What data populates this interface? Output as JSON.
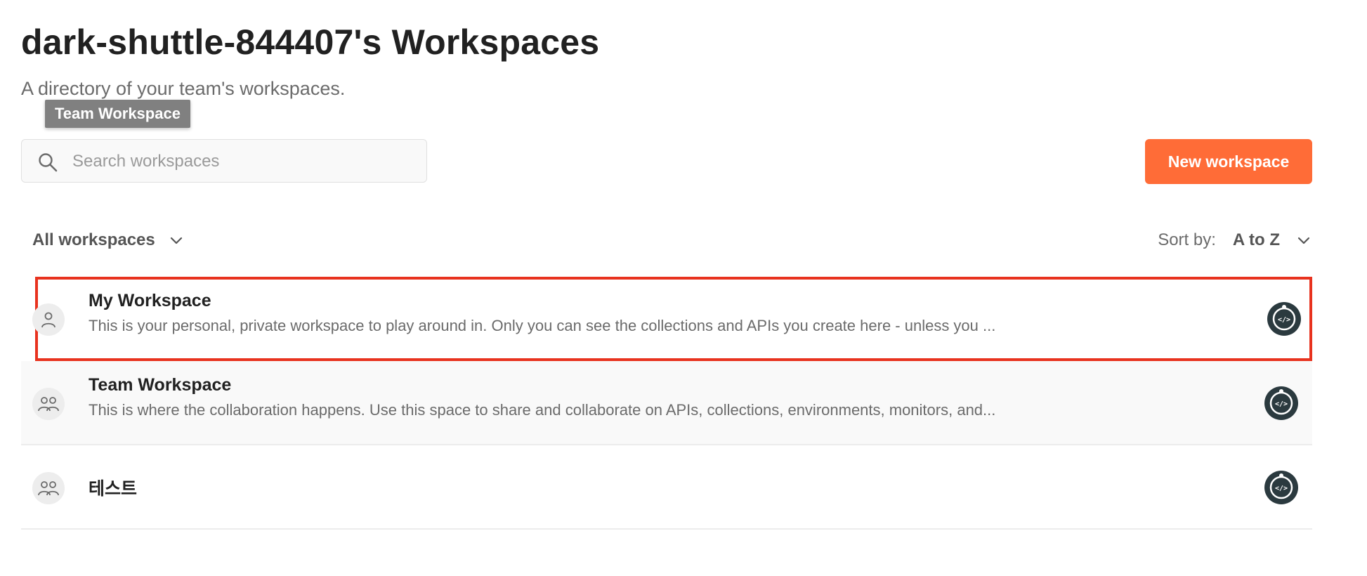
{
  "page": {
    "title": "dark-shuttle-844407's Workspaces",
    "subtitle": "A directory of your team's workspaces."
  },
  "tooltip": {
    "text": "Team Workspace"
  },
  "search": {
    "placeholder": "Search workspaces",
    "value": "",
    "icon": "search-icon"
  },
  "toolbar": {
    "new_workspace_label": "New workspace"
  },
  "filter": {
    "label": "All workspaces",
    "icon": "chevron-down-icon"
  },
  "sort": {
    "label": "Sort by:",
    "value": "A to Z",
    "icon": "chevron-down-icon"
  },
  "workspaces": [
    {
      "name": "My Workspace",
      "description": "This is your personal, private workspace to play around in. Only you can see the collections and APIs you create here - unless you ...",
      "type_icon": "personal-user-icon",
      "badge_icon": "api-badge-icon",
      "state": "selected"
    },
    {
      "name": "Team Workspace",
      "description": "This is where the collaboration happens. Use this space to share and collaborate on APIs, collections, environments, monitors, and...",
      "type_icon": "team-users-icon",
      "badge_icon": "api-badge-icon",
      "state": "hovered"
    },
    {
      "name": "테스트",
      "description": "",
      "type_icon": "team-users-icon",
      "badge_icon": "api-badge-icon",
      "state": "default"
    }
  ],
  "colors": {
    "accent": "#ff6c37",
    "highlight_border": "#e8321e",
    "badge": "#2b3a3f"
  }
}
